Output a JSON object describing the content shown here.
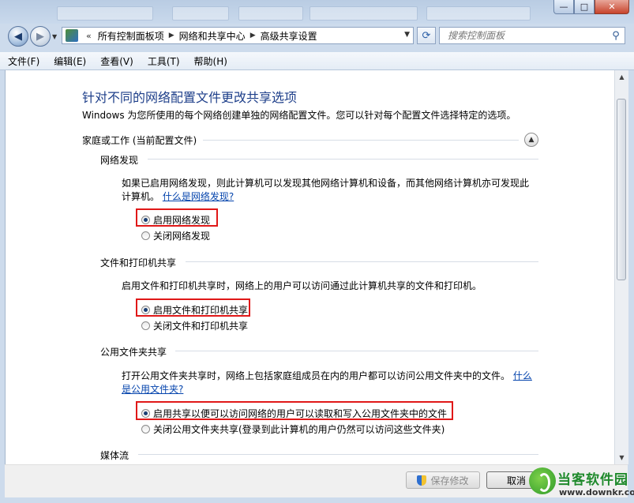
{
  "window": {
    "minimize": "—",
    "maximize": "□",
    "close": "✕"
  },
  "nav": {
    "back": "◀",
    "forward": "▶",
    "breadcrumbs": [
      "所有控制面板项",
      "网络和共享中心",
      "高级共享设置"
    ],
    "overflow": "«",
    "search_placeholder": "搜索控制面板"
  },
  "menu": [
    "文件(F)",
    "编辑(E)",
    "查看(V)",
    "工具(T)",
    "帮助(H)"
  ],
  "page": {
    "title": "针对不同的网络配置文件更改共享选项",
    "description": "Windows 为您所使用的每个网络创建单独的网络配置文件。您可以针对每个配置文件选择特定的选项。",
    "profile_heading": "家庭或工作 (当前配置文件)"
  },
  "discovery": {
    "heading": "网络发现",
    "text1": "如果已启用网络发现，则此计算机可以发现其他网络计算机和设备，而其他网络计算机亦可发现此",
    "text2": "计算机。",
    "link": "什么是网络发现?",
    "option_on": "启用网络发现",
    "option_off": "关闭网络发现"
  },
  "printer": {
    "heading": "文件和打印机共享",
    "text": "启用文件和打印机共享时，网络上的用户可以访问通过此计算机共享的文件和打印机。",
    "option_on": "启用文件和打印机共享",
    "option_off": "关闭文件和打印机共享"
  },
  "public": {
    "heading": "公用文件夹共享",
    "text": "打开公用文件夹共享时，网络上包括家庭组成员在内的用户都可以访问公用文件夹中的文件。",
    "link1": "什么",
    "link2": "是公用文件夹?",
    "option_on": "启用共享以便可以访问网络的用户可以读取和写入公用文件夹中的文件",
    "option_off": "关闭公用文件夹共享(登录到此计算机的用户仍然可以访问这些文件夹)"
  },
  "media": {
    "heading": "媒体流"
  },
  "footer": {
    "save": "保存修改",
    "cancel": "取消"
  },
  "watermark": {
    "name": "当客软件园",
    "url": "www.downkr.com"
  }
}
